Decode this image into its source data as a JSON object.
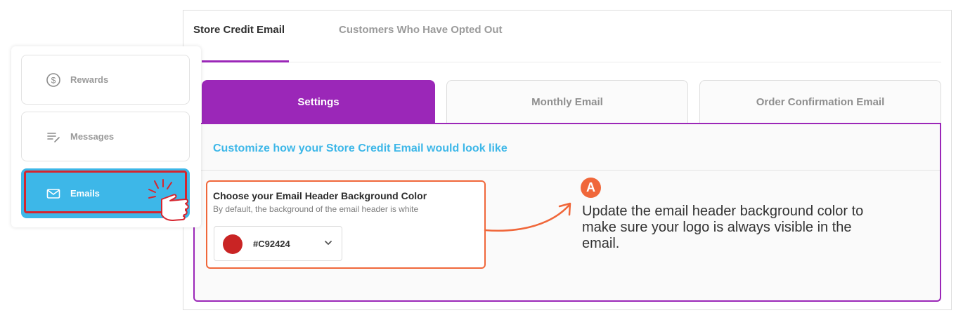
{
  "top_tabs": [
    {
      "label": "Store Credit Email",
      "active": true
    },
    {
      "label": "Customers Who Have Opted Out",
      "active": false
    }
  ],
  "sub_tabs": [
    {
      "label": "Settings",
      "active": true
    },
    {
      "label": "Monthly Email",
      "active": false
    },
    {
      "label": "Order Confirmation Email",
      "active": false
    }
  ],
  "content": {
    "heading": "Customize how your Store Credit Email would look like",
    "color_setting": {
      "title": "Choose your Email Header Background Color",
      "description": "By default, the background of the email header is white",
      "selected_value": "#C92424",
      "swatch_color": "#c92424",
      "dropdown_icon": "chevron-down-icon"
    }
  },
  "sidebar": {
    "items": [
      {
        "label": "Rewards",
        "icon": "dollar-circle-icon",
        "active": false
      },
      {
        "label": "Messages",
        "icon": "edit-list-icon",
        "active": false
      },
      {
        "label": "Emails",
        "icon": "envelope-icon",
        "active": true
      }
    ]
  },
  "annotation": {
    "badge": "A",
    "text": "Update the email header background color to make sure your logo is always visible in the email."
  },
  "colors": {
    "accent_purple": "#9b27b8",
    "accent_blue": "#3db7e8",
    "highlight_orange": "#f0673a",
    "highlight_red": "#d6252f"
  }
}
